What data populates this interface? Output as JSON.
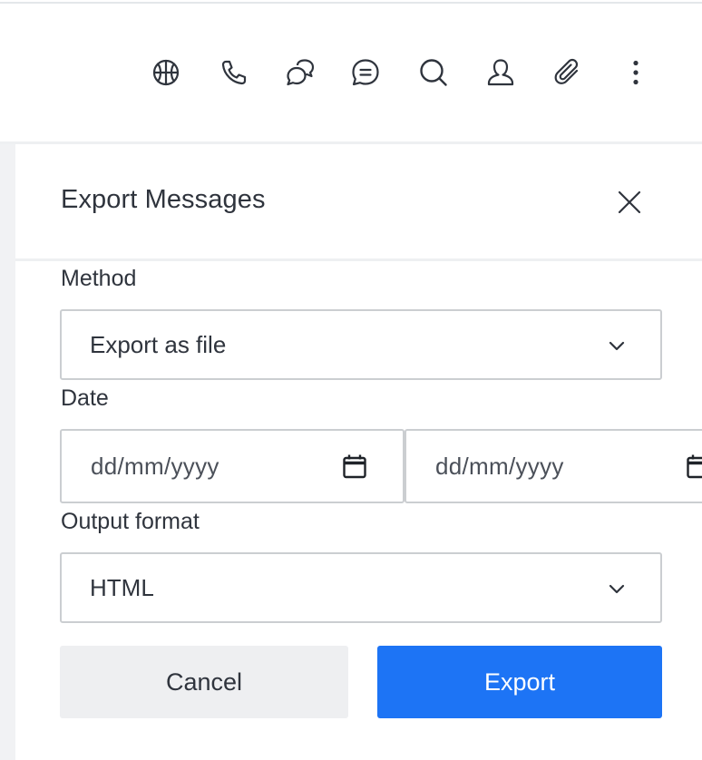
{
  "toolbar": {
    "icons": [
      "discussion-icon",
      "phone-icon",
      "threads-icon",
      "chat-icon",
      "search-icon",
      "user-icon",
      "attachment-icon",
      "kebab-menu-icon"
    ]
  },
  "panel": {
    "title": "Export Messages"
  },
  "form": {
    "method_label": "Method",
    "method_value": "Export as file",
    "date_label": "Date",
    "date_from_placeholder": "dd/mm/yyyy",
    "date_to_placeholder": "dd/mm/yyyy",
    "format_label": "Output format",
    "format_value": "HTML"
  },
  "actions": {
    "cancel_label": "Cancel",
    "export_label": "Export"
  },
  "colors": {
    "primary": "#1d74f5",
    "text": "#2f343d",
    "border": "#cbced1",
    "secondary_button": "#eeeff1"
  }
}
